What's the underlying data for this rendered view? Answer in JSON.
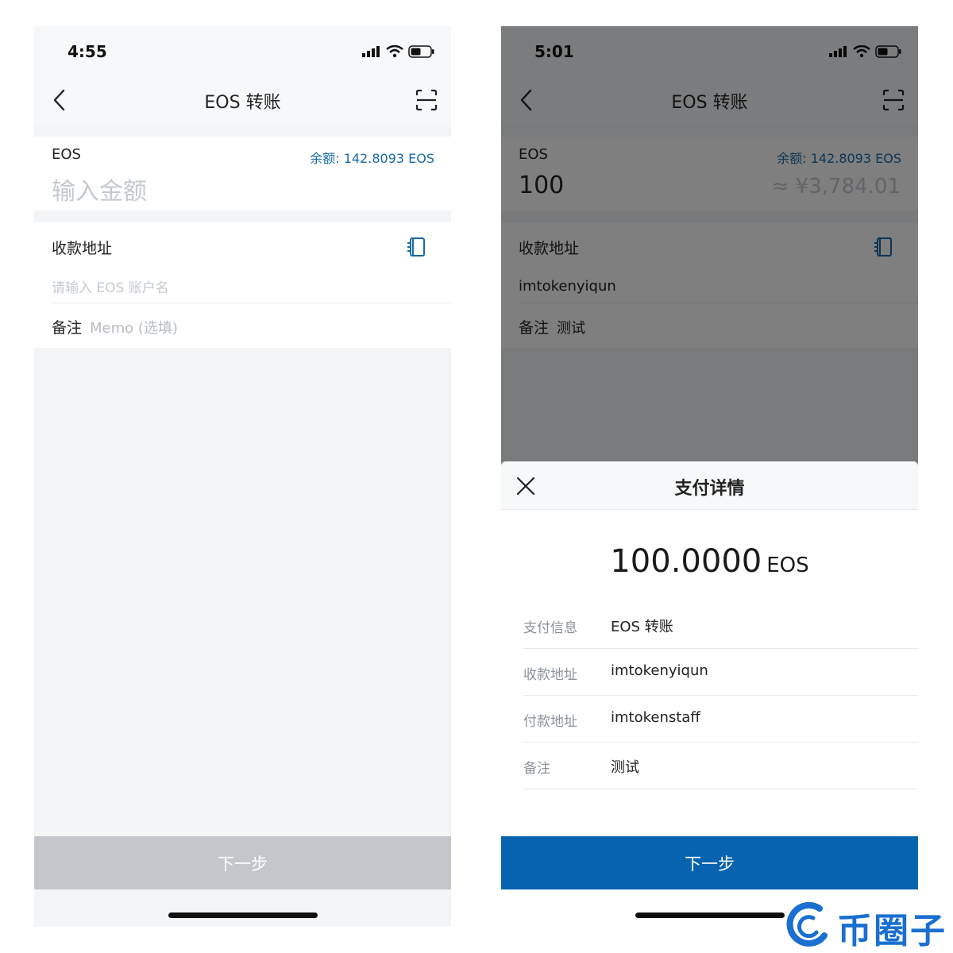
{
  "left_screen": {
    "status": {
      "time": "4:55"
    },
    "nav": {
      "title": "EOS 转账"
    },
    "amount": {
      "token": "EOS",
      "balance": "余额: 142.8093 EOS",
      "placeholder": "输入金额"
    },
    "address": {
      "label": "收款地址",
      "placeholder": "请输入 EOS 账户名"
    },
    "memo": {
      "label": "备注",
      "placeholder": "Memo (选填)"
    },
    "next_button": "下一步"
  },
  "right_screen": {
    "status": {
      "time": "5:01"
    },
    "nav": {
      "title": "EOS 转账"
    },
    "amount": {
      "token": "EOS",
      "balance": "余额: 142.8093 EOS",
      "value": "100",
      "fiat": "≈ ¥3,784.01"
    },
    "address": {
      "label": "收款地址",
      "value": "imtokenyiqun"
    },
    "memo": {
      "label": "备注",
      "value": "测试"
    },
    "sheet": {
      "title": "支付详情",
      "amount": "100.0000",
      "unit": "EOS",
      "rows": [
        {
          "label": "支付信息",
          "value": "EOS 转账"
        },
        {
          "label": "收款地址",
          "value": "imtokenyiqun"
        },
        {
          "label": "付款地址",
          "value": "imtokenstaff"
        },
        {
          "label": "备注",
          "value": "测试"
        }
      ]
    },
    "next_button": "下一步"
  },
  "watermark": {
    "text": "币圈子"
  },
  "colors": {
    "accent": "#0762b0",
    "link": "#1a6aa8",
    "disabled": "#c3c7cb",
    "watermark": "#1a6fd0"
  },
  "icons": [
    "chevron-left-icon",
    "scan-icon",
    "address-book-icon",
    "close-icon",
    "signal-icon",
    "wifi-icon",
    "battery-icon"
  ]
}
